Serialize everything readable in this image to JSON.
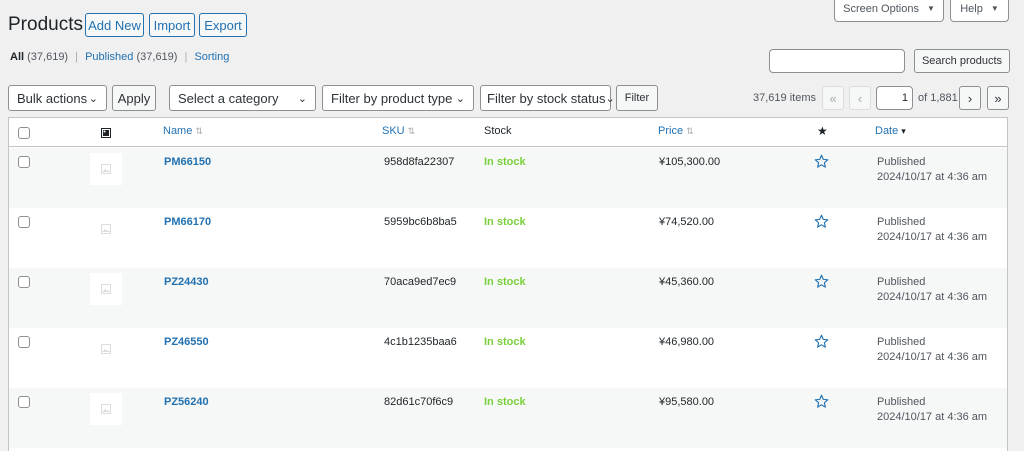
{
  "header": {
    "title": "Products",
    "add_new": "Add New",
    "import": "Import",
    "export": "Export",
    "screen_options": "Screen Options",
    "help": "Help"
  },
  "subsubsub": {
    "all_label": "All",
    "all_count": "(37,619)",
    "published_label": "Published",
    "published_count": "(37,619)",
    "sorting_label": "Sorting",
    "separator": "|"
  },
  "search": {
    "value": "",
    "button": "Search products"
  },
  "filters": {
    "bulk_actions": "Bulk actions",
    "apply": "Apply",
    "category": "Select a category",
    "product_type": "Filter by product type",
    "stock_status": "Filter by stock status",
    "filter": "Filter"
  },
  "pagination": {
    "items": "37,619 items",
    "first": "«",
    "prev": "‹",
    "current_page": "1",
    "of_pages": "of 1,881",
    "next": "›",
    "last": "»"
  },
  "columns": {
    "name": "Name",
    "sku": "SKU",
    "stock": "Stock",
    "price": "Price",
    "featured": "★",
    "date": "Date"
  },
  "rows": [
    {
      "name": "PM66150",
      "sku": "958d8fa22307",
      "stock": "In stock",
      "price": "¥105,300.00",
      "status": "Published",
      "date": "2024/10/17 at 4:36 am"
    },
    {
      "name": "PM66170",
      "sku": "5959bc6b8ba5",
      "stock": "In stock",
      "price": "¥74,520.00",
      "status": "Published",
      "date": "2024/10/17 at 4:36 am"
    },
    {
      "name": "PZ24430",
      "sku": "70aca9ed7ec9",
      "stock": "In stock",
      "price": "¥45,360.00",
      "status": "Published",
      "date": "2024/10/17 at 4:36 am"
    },
    {
      "name": "PZ46550",
      "sku": "4c1b1235baa6",
      "stock": "In stock",
      "price": "¥46,980.00",
      "status": "Published",
      "date": "2024/10/17 at 4:36 am"
    },
    {
      "name": "PZ56240",
      "sku": "82d61c70f6c9",
      "stock": "In stock",
      "price": "¥95,580.00",
      "status": "Published",
      "date": "2024/10/17 at 4:36 am"
    }
  ],
  "icons": {
    "thumbnail_column": "image-icon",
    "featured_column": "star-filled-icon",
    "row_featured": "star-outline-icon",
    "placeholder": "image-placeholder-icon"
  },
  "colors": {
    "link": "#2271b1",
    "in_stock": "#7ad03a",
    "background": "#f0f0f1"
  }
}
